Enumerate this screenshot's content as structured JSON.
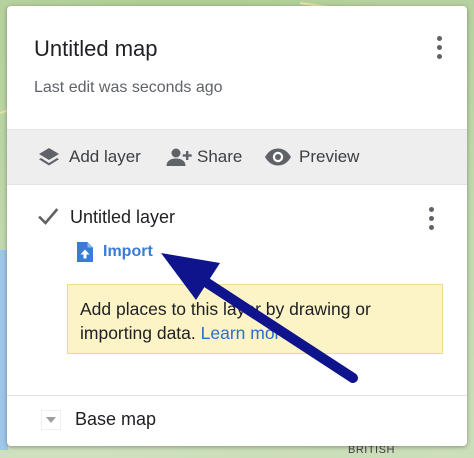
{
  "map": {
    "title": "Untitled map",
    "last_edit": "Last edit was seconds ago",
    "background_label": "BRITISH",
    "menu_icon": "more-vert-icon"
  },
  "toolbar": {
    "add_layer_label": "Add layer",
    "share_label": "Share",
    "preview_label": "Preview",
    "add_layer_icon": "layers-icon",
    "share_icon": "person-add-icon",
    "preview_icon": "eye-icon"
  },
  "layer": {
    "name": "Untitled layer",
    "checked": true,
    "import_label": "Import",
    "import_icon": "file-upload-icon",
    "hint_text": "Add places to this layer by drawing or importing data. ",
    "hint_link": "Learn more"
  },
  "base_map": {
    "label": "Base map",
    "icon": "triangle-down-icon"
  },
  "colors": {
    "accent_blue": "#3a7bd5",
    "hint_background": "#fcf3c7",
    "annotation_arrow": "#10148c",
    "toolbar_background": "#eeeeee"
  }
}
